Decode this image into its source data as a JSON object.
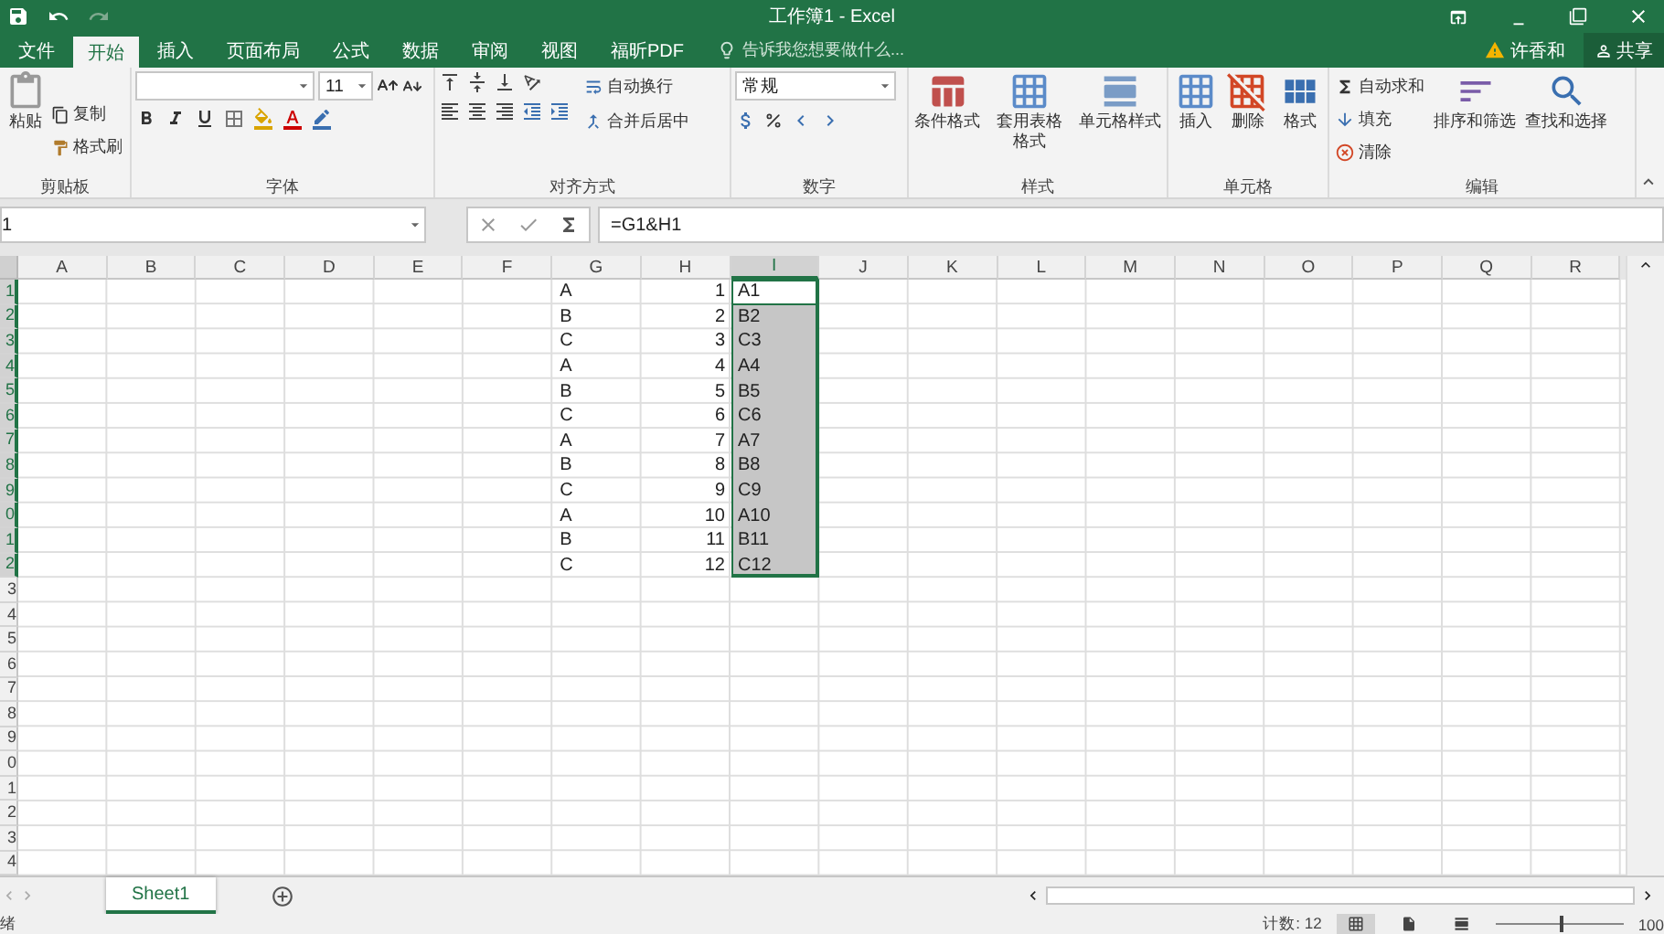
{
  "window": {
    "title": "工作簿1 - Excel"
  },
  "ribbon_tabs": [
    {
      "label": "文件",
      "selected": false
    },
    {
      "label": "开始",
      "selected": true
    },
    {
      "label": "插入",
      "selected": false
    },
    {
      "label": "页面布局",
      "selected": false
    },
    {
      "label": "公式",
      "selected": false
    },
    {
      "label": "数据",
      "selected": false
    },
    {
      "label": "审阅",
      "selected": false
    },
    {
      "label": "视图",
      "selected": false
    },
    {
      "label": "福昕PDF",
      "selected": false
    }
  ],
  "tell_me": {
    "placeholder": "告诉我您想要做什么..."
  },
  "user": {
    "name": "许香和",
    "share": "共享"
  },
  "ribbon": {
    "clipboard": {
      "paste": "粘贴",
      "copy": "复制",
      "format_painter": "格式刷",
      "label": "剪贴板"
    },
    "font": {
      "size": "11",
      "label": "字体"
    },
    "alignment": {
      "wrap": "自动换行",
      "merge": "合并后居中",
      "label": "对齐方式"
    },
    "number": {
      "format": "常规",
      "label": "数字"
    },
    "styles": {
      "conditional": "条件格式",
      "table": "套用表格格式",
      "cell_styles": "单元格样式",
      "label": "样式"
    },
    "cells": {
      "insert": "插入",
      "delete": "删除",
      "format": "格式",
      "label": "单元格"
    },
    "editing": {
      "autosum": "自动求和",
      "fill": "填充",
      "clear": "清除",
      "sort": "排序和筛选",
      "find": "查找和选择",
      "label": "编辑"
    }
  },
  "formula_bar": {
    "name_box": "1",
    "formula": "=G1&H1"
  },
  "columns": [
    {
      "label": "A",
      "selected": false
    },
    {
      "label": "B",
      "selected": false
    },
    {
      "label": "C",
      "selected": false
    },
    {
      "label": "D",
      "selected": false
    },
    {
      "label": "E",
      "selected": false
    },
    {
      "label": "F",
      "selected": false
    },
    {
      "label": "G",
      "selected": false
    },
    {
      "label": "H",
      "selected": false
    },
    {
      "label": "I",
      "selected": true
    },
    {
      "label": "J",
      "selected": false
    },
    {
      "label": "K",
      "selected": false
    },
    {
      "label": "L",
      "selected": false
    },
    {
      "label": "M",
      "selected": false
    },
    {
      "label": "N",
      "selected": false
    },
    {
      "label": "O",
      "selected": false
    },
    {
      "label": "P",
      "selected": false
    },
    {
      "label": "Q",
      "selected": false
    },
    {
      "label": "R",
      "selected": false
    }
  ],
  "rows": [
    {
      "header": "1",
      "col_g": "A",
      "col_h": "1",
      "col_i": "A1",
      "selected": true,
      "active": true
    },
    {
      "header": "2",
      "col_g": "B",
      "col_h": "2",
      "col_i": "B2",
      "selected": true,
      "active": false
    },
    {
      "header": "3",
      "col_g": "C",
      "col_h": "3",
      "col_i": "C3",
      "selected": true,
      "active": false
    },
    {
      "header": "4",
      "col_g": "A",
      "col_h": "4",
      "col_i": "A4",
      "selected": true,
      "active": false
    },
    {
      "header": "5",
      "col_g": "B",
      "col_h": "5",
      "col_i": "B5",
      "selected": true,
      "active": false
    },
    {
      "header": "6",
      "col_g": "C",
      "col_h": "6",
      "col_i": "C6",
      "selected": true,
      "active": false
    },
    {
      "header": "7",
      "col_g": "A",
      "col_h": "7",
      "col_i": "A7",
      "selected": true,
      "active": false
    },
    {
      "header": "8",
      "col_g": "B",
      "col_h": "8",
      "col_i": "B8",
      "selected": true,
      "active": false
    },
    {
      "header": "9",
      "col_g": "C",
      "col_h": "9",
      "col_i": "C9",
      "selected": true,
      "active": false
    },
    {
      "header": "0",
      "col_g": "A",
      "col_h": "10",
      "col_i": "A10",
      "selected": true,
      "active": false
    },
    {
      "header": "1",
      "col_g": "B",
      "col_h": "11",
      "col_i": "B11",
      "selected": true,
      "active": false
    },
    {
      "header": "2",
      "col_g": "C",
      "col_h": "12",
      "col_i": "C12",
      "selected": true,
      "active": false
    },
    {
      "header": "3",
      "selected": false,
      "active": false
    },
    {
      "header": "4",
      "selected": false,
      "active": false
    },
    {
      "header": "5",
      "selected": false,
      "active": false
    },
    {
      "header": "6",
      "selected": false,
      "active": false
    },
    {
      "header": "7",
      "selected": false,
      "active": false
    },
    {
      "header": "8",
      "selected": false,
      "active": false
    },
    {
      "header": "9",
      "selected": false,
      "active": false
    },
    {
      "header": "0",
      "selected": false,
      "active": false
    },
    {
      "header": "1",
      "selected": false,
      "active": false
    },
    {
      "header": "2",
      "selected": false,
      "active": false
    },
    {
      "header": "3",
      "selected": false,
      "active": false
    },
    {
      "header": "4",
      "selected": false,
      "active": false
    }
  ],
  "sheet_tabs": [
    {
      "label": "Sheet1",
      "selected": true
    }
  ],
  "status_bar": {
    "status": "绪",
    "count": "计数: 12",
    "zoom": "100",
    "zoom_slider": {
      "level": 0.5
    }
  }
}
